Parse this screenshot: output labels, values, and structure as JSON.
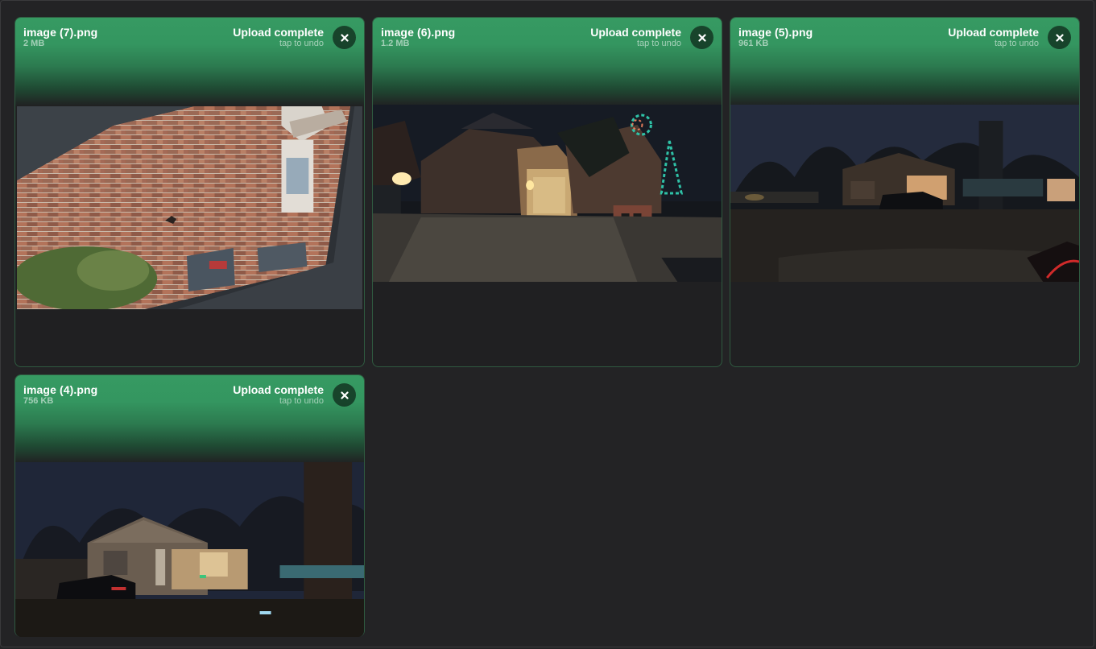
{
  "uploads": [
    {
      "filename": "image (7).png",
      "size": "2 MB",
      "status": "Upload complete",
      "undo_hint": "tap to undo",
      "close_icon": "close-icon"
    },
    {
      "filename": "image (6).png",
      "size": "1.2 MB",
      "status": "Upload complete",
      "undo_hint": "tap to undo",
      "close_icon": "close-icon"
    },
    {
      "filename": "image (5).png",
      "size": "961 KB",
      "status": "Upload complete",
      "undo_hint": "tap to undo",
      "close_icon": "close-icon"
    },
    {
      "filename": "image (4).png",
      "size": "756 KB",
      "status": "Upload complete",
      "undo_hint": "tap to undo",
      "close_icon": "close-icon"
    }
  ],
  "colors": {
    "success": "#369a62",
    "background": "#232325"
  }
}
